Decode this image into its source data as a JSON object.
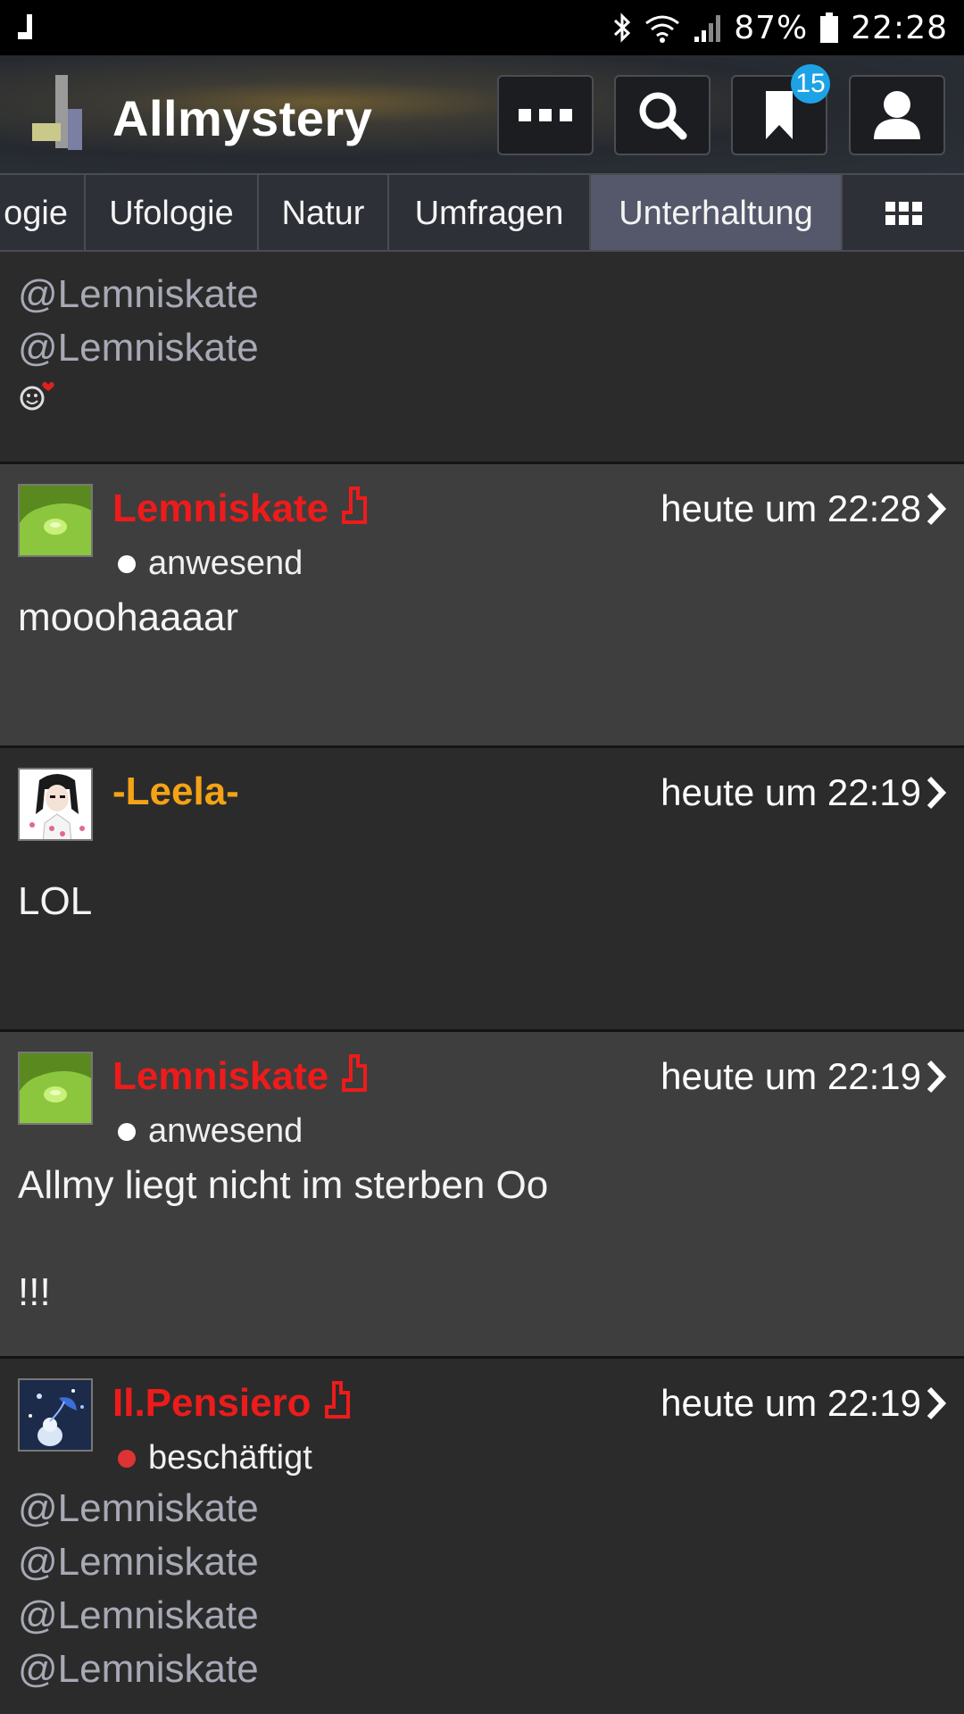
{
  "statusbar": {
    "battery_percent": "87%",
    "clock": "22:28",
    "icons": [
      "allmystery-notification-icon",
      "bluetooth-icon",
      "wifi-icon",
      "signal-icon",
      "battery-icon"
    ]
  },
  "header": {
    "title": "Allmystery",
    "bookmark_badge": "15",
    "buttons": [
      "more-icon",
      "search-icon",
      "bookmark-icon",
      "profile-icon"
    ]
  },
  "tabs": {
    "items": [
      "ogie",
      "Ufologie",
      "Natur",
      "Umfragen",
      "Unterhaltung"
    ],
    "active": "Unterhaltung"
  },
  "posts": [
    {
      "mentions": [
        "@Lemniskate",
        "@Lemniskate"
      ],
      "emoji": "smiley-heart-icon"
    },
    {
      "username": "Lemniskate",
      "time": "heute um 22:28",
      "status": "anwesend",
      "message": "mooohaaaar"
    },
    {
      "username": "-Leela-",
      "time": "heute um 22:19",
      "message": "LOL"
    },
    {
      "username": "Lemniskate",
      "time": "heute um 22:19",
      "status": "anwesend",
      "message_line1": "Allmy liegt nicht im sterben Oo",
      "message_line2": "!!!"
    },
    {
      "username": "Il.Pensiero",
      "time": "heute um 22:19",
      "status": "beschäftigt",
      "mentions": [
        "@Lemniskate",
        "@Lemniskate",
        "@Lemniskate",
        "@Lemniskate"
      ]
    }
  ],
  "colors": {
    "accent_red": "#ee1b1b",
    "accent_orange": "#f5a315",
    "badge_blue": "#1ea2e6",
    "active_tab": "#55586a"
  }
}
